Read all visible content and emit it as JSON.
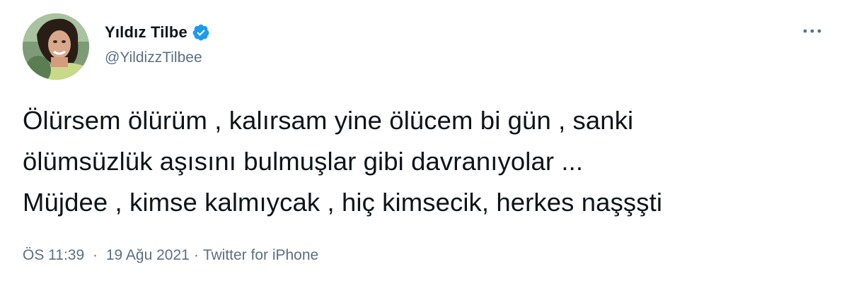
{
  "author": {
    "display_name": "Yıldız Tilbe",
    "handle": "@YildizzTilbee",
    "verified": true
  },
  "tweet": {
    "text": "Ölürsem ölürüm , kalırsam yine ölücem bi gün , sanki\nölümsüzlük aşısını bulmuşlar gibi davranıyolar ...\nMüjdee , kimse kalmıycak , hiç kimsecik, herkes naşşşti",
    "time": "ÖS 11:39",
    "date": "19 Ağu 2021",
    "source": "Twitter for iPhone",
    "separator": "·"
  },
  "icons": {
    "verified": "verified-badge-icon",
    "more": "more-horizontal-icon"
  },
  "colors": {
    "verified_blue": "#1d9bf0",
    "secondary_text": "#5b7083",
    "primary_text": "#0f1419"
  }
}
